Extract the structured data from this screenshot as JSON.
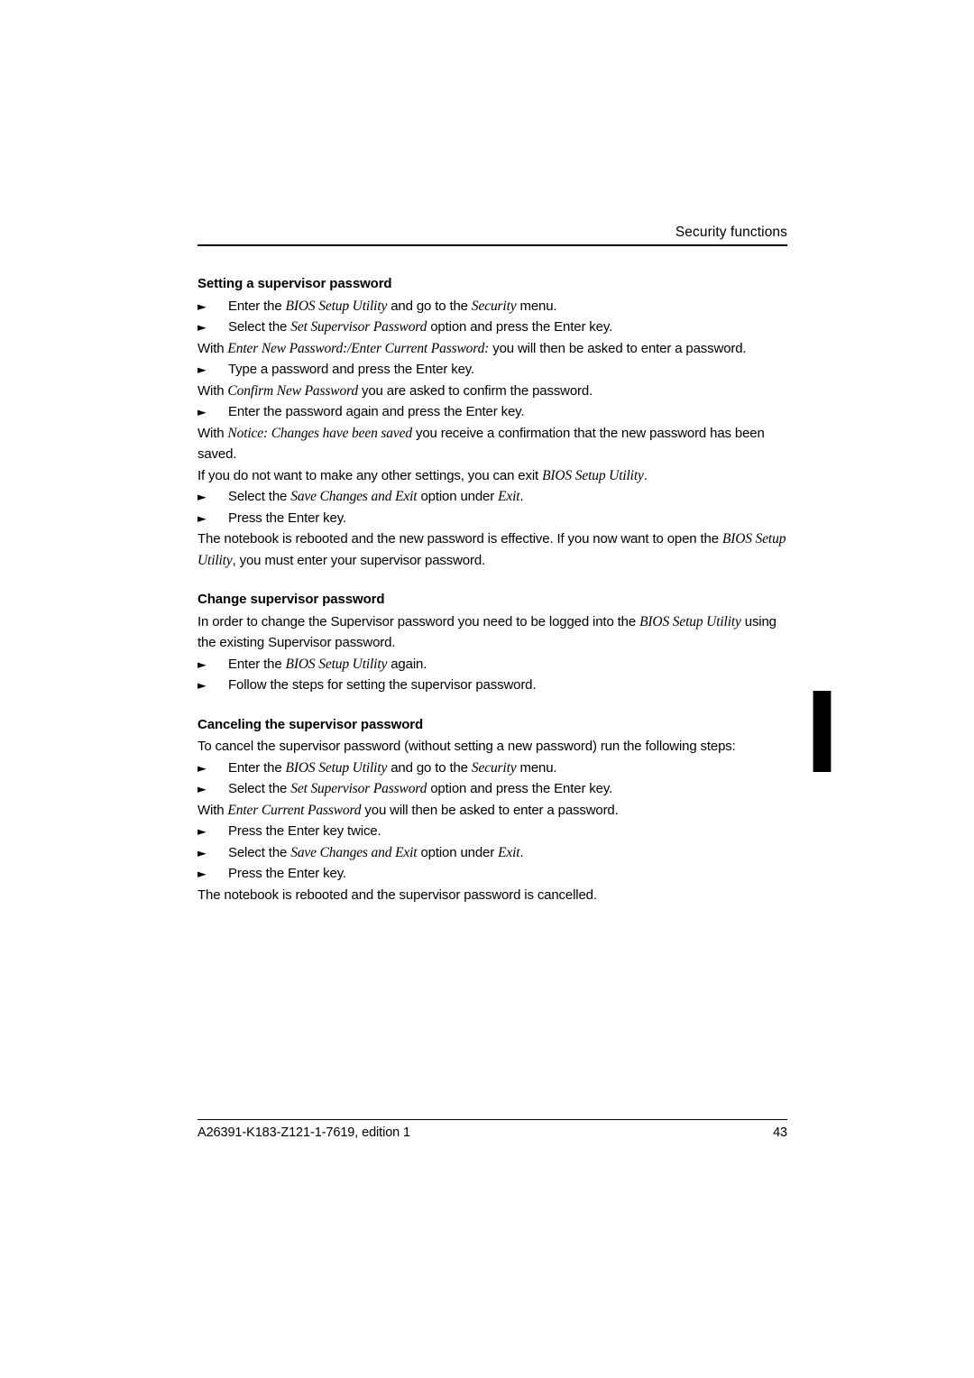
{
  "header": {
    "title": "Security functions"
  },
  "sections": [
    {
      "heading": "Setting a supervisor password",
      "blocks": [
        {
          "kind": "step",
          "bullet": "►",
          "runs": [
            {
              "t": "Enter the "
            },
            {
              "t": "BIOS Setup Utility",
              "style": "term"
            },
            {
              "t": " and go to the "
            },
            {
              "t": "Security",
              "style": "term"
            },
            {
              "t": " menu."
            }
          ]
        },
        {
          "kind": "step",
          "bullet": "►",
          "runs": [
            {
              "t": "Select the "
            },
            {
              "t": "Set Supervisor Password",
              "style": "term"
            },
            {
              "t": " option and press the Enter key."
            }
          ]
        },
        {
          "kind": "para",
          "runs": [
            {
              "t": "With "
            },
            {
              "t": "Enter New Password:/Enter Current Password:",
              "style": "term"
            },
            {
              "t": " you will then be asked to enter a password."
            }
          ]
        },
        {
          "kind": "step",
          "bullet": "►",
          "runs": [
            {
              "t": "Type a password and press the Enter key."
            }
          ]
        },
        {
          "kind": "para",
          "runs": [
            {
              "t": "With "
            },
            {
              "t": "Confirm New Password",
              "style": "term"
            },
            {
              "t": " you are asked to confirm the password."
            }
          ]
        },
        {
          "kind": "step",
          "bullet": "►",
          "runs": [
            {
              "t": "Enter the password again and press the Enter key."
            }
          ]
        },
        {
          "kind": "para",
          "runs": [
            {
              "t": "With "
            },
            {
              "t": "Notice: Changes have been saved",
              "style": "term"
            },
            {
              "t": " you receive a confirmation that the new password has been saved."
            }
          ]
        },
        {
          "kind": "para",
          "runs": [
            {
              "t": "If you do not want to make any other settings, you can exit "
            },
            {
              "t": "BIOS Setup Utility",
              "style": "term"
            },
            {
              "t": "."
            }
          ]
        },
        {
          "kind": "step",
          "bullet": "►",
          "runs": [
            {
              "t": "Select the "
            },
            {
              "t": "Save Changes and Exit",
              "style": "term"
            },
            {
              "t": " option under "
            },
            {
              "t": "Exit",
              "style": "term"
            },
            {
              "t": "."
            }
          ]
        },
        {
          "kind": "step",
          "bullet": "►",
          "runs": [
            {
              "t": "Press the Enter key."
            }
          ]
        },
        {
          "kind": "para",
          "runs": [
            {
              "t": "The notebook is rebooted and the new password is effective. If you now want to open the "
            },
            {
              "t": "BIOS Setup Utility",
              "style": "term"
            },
            {
              "t": ", you must enter your supervisor password."
            }
          ]
        }
      ]
    },
    {
      "heading": "Change supervisor password",
      "blocks": [
        {
          "kind": "para",
          "runs": [
            {
              "t": "In order to change the Supervisor password you need to be logged into the "
            },
            {
              "t": "BIOS Setup Utility",
              "style": "term"
            },
            {
              "t": " using the existing Supervisor password."
            }
          ]
        },
        {
          "kind": "step",
          "bullet": "►",
          "runs": [
            {
              "t": "Enter the "
            },
            {
              "t": "BIOS Setup Utility",
              "style": "term"
            },
            {
              "t": " again."
            }
          ]
        },
        {
          "kind": "step",
          "bullet": "►",
          "runs": [
            {
              "t": "Follow the steps for setting the supervisor password."
            }
          ]
        }
      ]
    },
    {
      "heading": "Canceling the supervisor password",
      "blocks": [
        {
          "kind": "para",
          "runs": [
            {
              "t": "To cancel the supervisor password (without setting a new password) run the following steps:"
            }
          ]
        },
        {
          "kind": "step",
          "bullet": "►",
          "runs": [
            {
              "t": "Enter the "
            },
            {
              "t": "BIOS Setup Utility",
              "style": "term"
            },
            {
              "t": " and go to the "
            },
            {
              "t": "Security",
              "style": "term"
            },
            {
              "t": " menu."
            }
          ]
        },
        {
          "kind": "step",
          "bullet": "►",
          "runs": [
            {
              "t": "Select the "
            },
            {
              "t": "Set Supervisor Password",
              "style": "term"
            },
            {
              "t": " option and press the Enter key."
            }
          ]
        },
        {
          "kind": "para",
          "runs": [
            {
              "t": "With "
            },
            {
              "t": "Enter Current Password",
              "style": "term"
            },
            {
              "t": " you will then be asked to enter a password."
            }
          ]
        },
        {
          "kind": "step",
          "bullet": "►",
          "runs": [
            {
              "t": "Press the Enter key twice."
            }
          ]
        },
        {
          "kind": "step",
          "bullet": "►",
          "runs": [
            {
              "t": "Select the "
            },
            {
              "t": "Save Changes and Exit",
              "style": "term"
            },
            {
              "t": " option under "
            },
            {
              "t": "Exit",
              "style": "term"
            },
            {
              "t": "."
            }
          ]
        },
        {
          "kind": "step",
          "bullet": "►",
          "runs": [
            {
              "t": "Press the Enter key."
            }
          ]
        },
        {
          "kind": "para",
          "runs": [
            {
              "t": "The notebook is rebooted and the supervisor password is cancelled."
            }
          ]
        }
      ]
    }
  ],
  "thumb_index": {
    "name": "thumb-index-marker",
    "color": "#000000"
  },
  "footer": {
    "document_id": "A26391-K183-Z121-1-7619, edition 1",
    "page_number": "43"
  }
}
